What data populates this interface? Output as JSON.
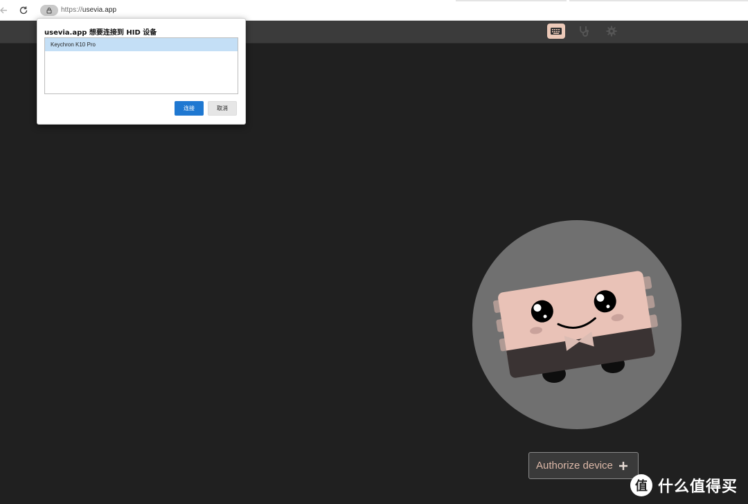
{
  "browser": {
    "url_scheme": "https://",
    "url_host": "usevia.app"
  },
  "header": {
    "icons": [
      "keyboard-icon",
      "stethoscope-icon",
      "gear-icon"
    ],
    "active_icon_color": "#ecc9b8"
  },
  "hid_dialog": {
    "title": "usevia.app 想要连接到 HID 设备",
    "devices": [
      {
        "name": "Keychron K10 Pro",
        "selected": true
      }
    ],
    "connect_label": "连接",
    "cancel_label": "取消",
    "connect_color": "#1f78d1"
  },
  "main": {
    "authorize_label": "Authorize device",
    "accent_color": "#dcb8a8"
  },
  "watermark": {
    "logo_glyph": "值",
    "text": "什么值得买"
  }
}
